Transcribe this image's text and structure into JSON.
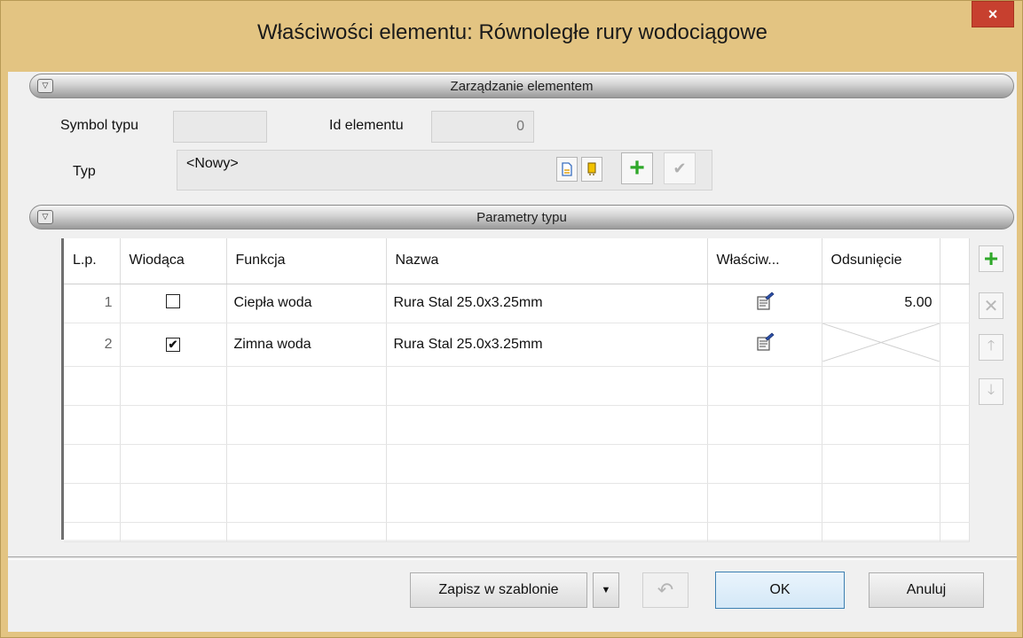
{
  "window": {
    "title": "Właściwości elementu: Równoległe rury wodociągowe",
    "close_glyph": "×"
  },
  "section1": {
    "title": "Zarządzanie elementem"
  },
  "element": {
    "symbol_label": "Symbol typu",
    "symbol_value": "",
    "id_label": "Id elementu",
    "id_value": "0",
    "typ_label": "Typ",
    "typ_value": "<Nowy>"
  },
  "section2": {
    "title": "Parametry typu"
  },
  "table": {
    "columns": [
      "L.p.",
      "Wiodąca",
      "Funkcja",
      "Nazwa",
      "Właściw...",
      "Odsunięcie"
    ],
    "rows": [
      {
        "lp": "1",
        "wiodaca": false,
        "check": "",
        "funkcja": "Ciepła woda",
        "nazwa": "Rura Stal 25.0x3.25mm",
        "odsuniecie": "5.00"
      },
      {
        "lp": "2",
        "wiodaca": true,
        "check": "✔",
        "funkcja": "Zimna woda",
        "nazwa": "Rura Stal 25.0x3.25mm",
        "odsuniecie": ""
      }
    ]
  },
  "buttons": {
    "save_template": "Zapisz w szablonie",
    "ok": "OK",
    "cancel": "Anuluj"
  },
  "icons": {
    "new_doc": "new-document-icon",
    "db": "database-icon",
    "add": "plus-icon",
    "confirm": "checkmark-icon",
    "props": "properties-icon",
    "delete": "delete-icon",
    "up": "arrow-up-icon",
    "down": "arrow-down-icon",
    "undo": "undo-icon",
    "dropdown": "dropdown-arrow-icon"
  },
  "colors": {
    "frame": "#e3c482",
    "close": "#c7402f",
    "plus": "#2fa82a"
  }
}
